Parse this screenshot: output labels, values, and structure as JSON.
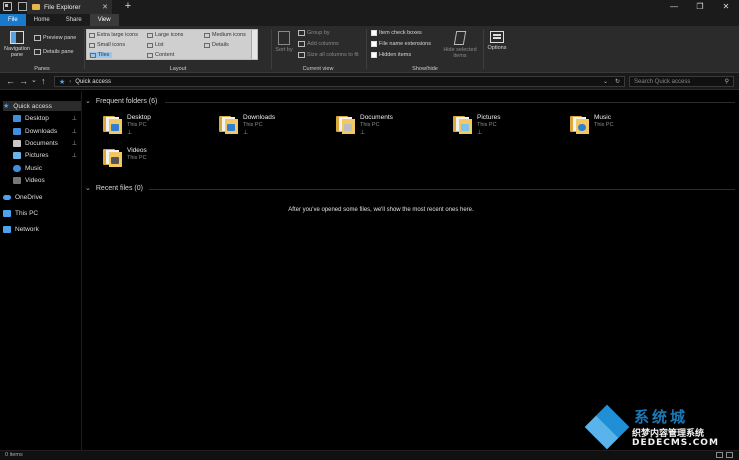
{
  "window": {
    "tab_title": "File Explorer",
    "tab_close": "✕",
    "new_tab": "+",
    "minimize": "—",
    "maximize": "❐",
    "close": "✕"
  },
  "ribbon_tabs": [
    "File",
    "Home",
    "Share",
    "View"
  ],
  "ribbon": {
    "panes": {
      "navigation_pane": "Navigation pane",
      "preview_pane": "Preview pane",
      "details_pane": "Details pane",
      "label": "Panes"
    },
    "layout": {
      "extra_large_icons": "Extra large icons",
      "large_icons": "Large icons",
      "medium_icons": "Medium icons",
      "small_icons": "Small icons",
      "list": "List",
      "details": "Details",
      "tiles": "Tiles",
      "content": "Content",
      "label": "Layout"
    },
    "current_view": {
      "sort_by": "Sort by",
      "group_by": "Group by",
      "add_columns": "Add columns",
      "size_all_columns": "Size all columns to fit",
      "label": "Current view"
    },
    "show_hide": {
      "item_check_boxes": "Item check boxes",
      "file_name_extensions": "File name extensions",
      "hidden_items": "Hidden items",
      "hide_selected_items": "Hide selected items",
      "label": "Show/hide"
    },
    "options": "Options"
  },
  "address": {
    "back": "←",
    "forward": "→",
    "recent": "⌄",
    "up": "↑",
    "path": "Quick access",
    "dropdown": "⌄",
    "refresh": "↻",
    "search_placeholder": "Search Quick access",
    "search_icon": "⚲"
  },
  "sidebar": {
    "items": [
      {
        "label": "Quick access",
        "icon": "star-icon",
        "color": "#4ea3ef"
      },
      {
        "label": "Desktop",
        "icon": "desktop-icon",
        "color": "#3f8fdc"
      },
      {
        "label": "Downloads",
        "icon": "downloads-icon",
        "color": "#3f8fdc"
      },
      {
        "label": "Documents",
        "icon": "documents-icon",
        "color": "#c8c8c8"
      },
      {
        "label": "Pictures",
        "icon": "pictures-icon",
        "color": "#6bb3e8"
      },
      {
        "label": "Music",
        "icon": "music-icon",
        "color": "#3f8fdc"
      },
      {
        "label": "Videos",
        "icon": "videos-icon",
        "color": "#777777"
      },
      {
        "label": "OneDrive",
        "icon": "onedrive-icon",
        "color": "#4ea3ef"
      },
      {
        "label": "This PC",
        "icon": "this-pc-icon",
        "color": "#4ea3ef"
      },
      {
        "label": "Network",
        "icon": "network-icon",
        "color": "#4ea3ef"
      }
    ],
    "pin": "📌"
  },
  "main": {
    "frequent_header": "Frequent folders (6)",
    "recent_header": "Recent files (0)",
    "chevron": "⌄",
    "folders": [
      {
        "name": "Desktop",
        "location": "This PC",
        "badge": "#2f7fd3"
      },
      {
        "name": "Downloads",
        "location": "This PC",
        "badge": "#2f7fd3"
      },
      {
        "name": "Documents",
        "location": "This PC",
        "badge": "#bdbdbd"
      },
      {
        "name": "Pictures",
        "location": "This PC",
        "badge": "#7ec3ee"
      },
      {
        "name": "Music",
        "location": "This PC",
        "badge": "#2f7fd3"
      },
      {
        "name": "Videos",
        "location": "This PC",
        "badge": "#555555"
      }
    ],
    "pin": "✎",
    "empty_message": "After you've opened some files, we'll show the most recent ones here."
  },
  "status": {
    "items_count": "0 items"
  },
  "watermark": {
    "title": "系统城",
    "subtitle": "织梦内容管理系统",
    "url": "DEDECMS.COM"
  }
}
